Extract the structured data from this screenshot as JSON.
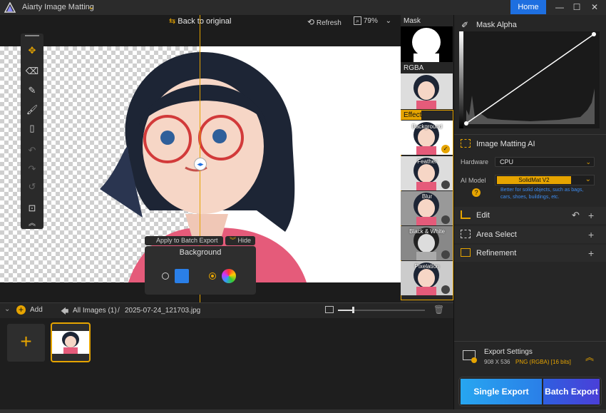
{
  "app": {
    "title": "Aiarty Image Matting",
    "menu_caret": "⌄",
    "home_label": "Home"
  },
  "window_controls": {
    "minimize": "—",
    "maximize": "☐",
    "close": "✕"
  },
  "canvas": {
    "back_to_original": "Back to original",
    "refresh": "Refresh",
    "zoom": "79%",
    "apply_batch": "Apply to Batch Export",
    "hide": "Hide",
    "background_title": "Background"
  },
  "strip": {
    "mask_label": "Mask",
    "rgba_label": "RGBA",
    "effect_label": "Effect",
    "effects": [
      "Background",
      "Feather",
      "Blur",
      "Black & White",
      "Pixelation"
    ]
  },
  "filebar": {
    "add_label": "Add",
    "all_images": "All Images (1)",
    "separator": "/",
    "filename": "2025-07-24_121703.jpg"
  },
  "right": {
    "mask_alpha_title": "Mask Alpha",
    "matting_title": "Image Matting AI",
    "hardware_label": "Hardware",
    "hardware_value": "CPU",
    "ai_model_label": "AI Model",
    "ai_model_value": "SolidMat  V2",
    "ai_model_desc": "Better for solid objects, such as bags, cars, shoes, buildings, etc.",
    "edit_title": "Edit",
    "area_select_title": "Area Select",
    "refinement_title": "Refinement",
    "export_settings_title": "Export Settings",
    "export_size": "908 X 536",
    "export_format": "PNG (RGBA) [16 bits]",
    "single_export": "Single Export",
    "batch_export": "Batch Export"
  },
  "colors": {
    "accent": "#e6a400",
    "home_blue": "#1e6fe0",
    "desc_blue": "#3d8cf0"
  },
  "icons": [
    "move-icon",
    "eraser-icon",
    "brush-icon",
    "restore-brush-icon",
    "bucket-icon",
    "undo-icon",
    "redo-icon",
    "reset-icon",
    "fit-icon",
    "collapse-icon",
    "refresh-icon",
    "zoom-icon",
    "back-arrow-icon",
    "check-icon",
    "add-icon",
    "arrow-left-icon",
    "image-icon",
    "trash-icon",
    "pipette-icon",
    "help-icon",
    "export-icon"
  ]
}
